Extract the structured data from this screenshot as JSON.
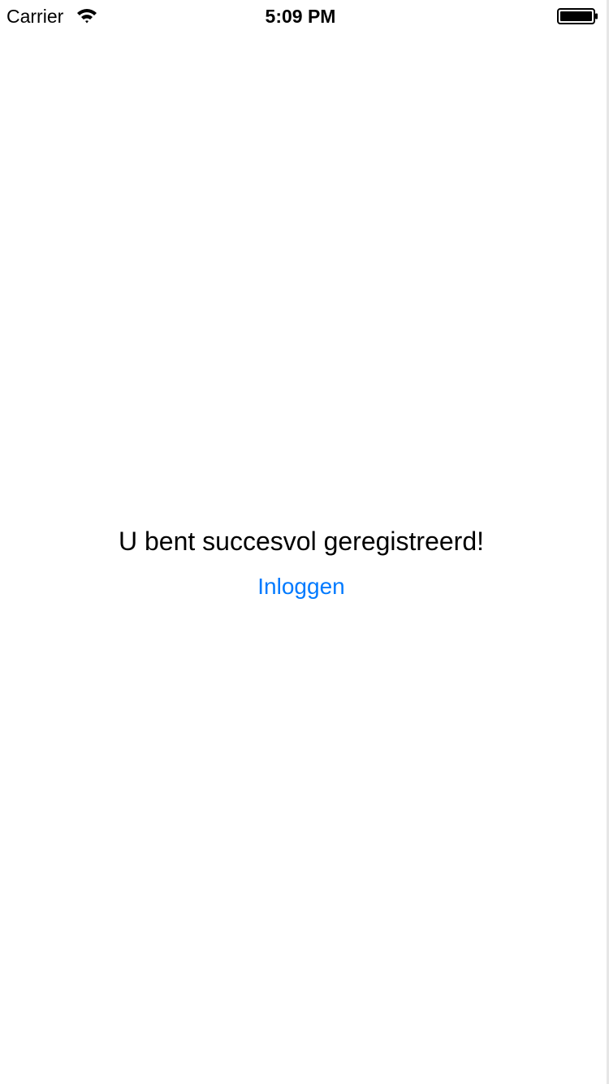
{
  "status_bar": {
    "carrier": "Carrier",
    "time": "5:09 PM",
    "wifi_icon": "wifi-icon",
    "battery_icon": "battery-icon"
  },
  "main": {
    "message": "U bent succesvol geregistreerd!",
    "login_label": "Inloggen"
  },
  "colors": {
    "accent": "#007aff",
    "background": "#ffffff",
    "text": "#000000"
  }
}
